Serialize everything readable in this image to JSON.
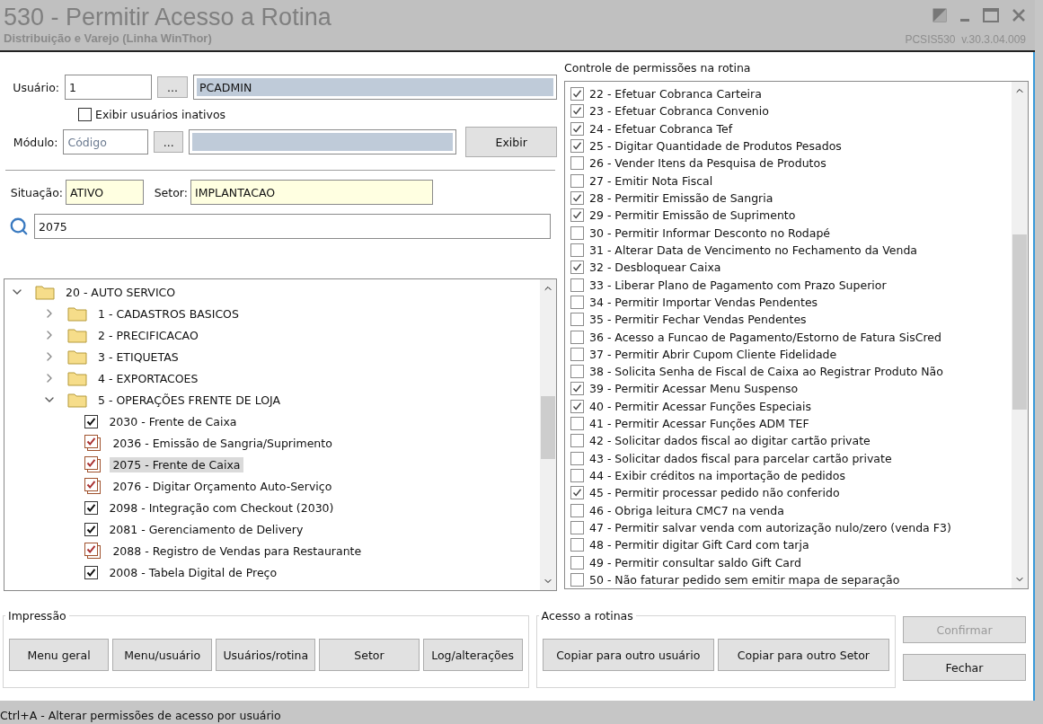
{
  "window": {
    "title": "530 - Permitir Acesso a Rotina",
    "subtitle": "Distribuição e Varejo (Linha WinThor)",
    "version": "PCSIS530  v.30.3.04.009"
  },
  "user": {
    "label": "Usuário:",
    "code": "1",
    "lookup": "...",
    "name": "PCADMIN"
  },
  "show_inactive": {
    "label": "Exibir usuários inativos",
    "checked": false
  },
  "module": {
    "label": "Módulo:",
    "placeholder": "Código",
    "lookup": "...",
    "button": "Exibir"
  },
  "situation": {
    "label": "Situação:",
    "value": "ATIVO"
  },
  "sector": {
    "label": "Setor:",
    "value": "IMPLANTACAO"
  },
  "search": {
    "value": "2075"
  },
  "tree": [
    {
      "label": "20 - AUTO SERVICO",
      "kind": "folder",
      "expanded": true,
      "children": [
        {
          "label": "1 - CADASTROS BASICOS",
          "kind": "folder",
          "expanded": false
        },
        {
          "label": "2 - PRECIFICACAO",
          "kind": "folder",
          "expanded": false
        },
        {
          "label": "3 - ETIQUETAS",
          "kind": "folder",
          "expanded": false
        },
        {
          "label": "4 - EXPORTACOES",
          "kind": "folder",
          "expanded": false
        },
        {
          "label": "5 - OPERAÇÕES FRENTE DE LOJA",
          "kind": "folder",
          "expanded": true,
          "children": [
            {
              "label": "2030 - Frente de Caixa",
              "kind": "routine",
              "checked": true,
              "multiple": false,
              "selected": false
            },
            {
              "label": "2036 - Emissão de Sangria/Suprimento",
              "kind": "routine",
              "checked": true,
              "multiple": true,
              "selected": false
            },
            {
              "label": "2075 - Frente de Caixa",
              "kind": "routine",
              "checked": true,
              "multiple": true,
              "selected": true
            },
            {
              "label": "2076 - Digitar Orçamento Auto-Serviço",
              "kind": "routine",
              "checked": true,
              "multiple": true,
              "selected": false
            },
            {
              "label": "2098 - Integração com Checkout (2030)",
              "kind": "routine",
              "checked": true,
              "multiple": false,
              "selected": false
            },
            {
              "label": "2081 - Gerenciamento de Delivery",
              "kind": "routine",
              "checked": true,
              "multiple": false,
              "selected": false
            },
            {
              "label": "2088 - Registro de Vendas para Restaurante",
              "kind": "routine",
              "checked": true,
              "multiple": true,
              "selected": false
            },
            {
              "label": "2008 - Tabela Digital de Preço",
              "kind": "routine",
              "checked": true,
              "multiple": false,
              "selected": false
            }
          ]
        }
      ]
    }
  ],
  "permissions": {
    "title": "Controle de permissões na rotina",
    "items": [
      {
        "label": "22 - Efetuar Cobranca Carteira",
        "checked": true
      },
      {
        "label": "23 - Efetuar Cobranca Convenio",
        "checked": true
      },
      {
        "label": "24 - Efetuar Cobranca Tef",
        "checked": true
      },
      {
        "label": "25 - Digitar Quantidade de Produtos Pesados",
        "checked": true
      },
      {
        "label": "26 - Vender Itens da Pesquisa de Produtos",
        "checked": false
      },
      {
        "label": "27 - Emitir Nota Fiscal",
        "checked": false
      },
      {
        "label": "28 - Permitir Emissão de Sangria",
        "checked": true
      },
      {
        "label": "29 - Permitir Emissão de Suprimento",
        "checked": true
      },
      {
        "label": "30 - Permitir Informar Desconto no Rodapé",
        "checked": false
      },
      {
        "label": "31 - Alterar Data de Vencimento no Fechamento da Venda",
        "checked": false
      },
      {
        "label": "32 - Desbloquear Caixa",
        "checked": true
      },
      {
        "label": "33 - Liberar Plano de Pagamento com Prazo Superior",
        "checked": false
      },
      {
        "label": "34 - Permitir Importar Vendas Pendentes",
        "checked": false
      },
      {
        "label": "35 - Permitir Fechar Vendas Pendentes",
        "checked": false
      },
      {
        "label": "36 - Acesso a Funcao de Pagamento/Estorno de Fatura SisCred",
        "checked": false
      },
      {
        "label": "37 - Permitir Abrir Cupom Cliente Fidelidade",
        "checked": false
      },
      {
        "label": "38 - Solicita Senha de Fiscal de Caixa ao Registrar Produto Não",
        "checked": false
      },
      {
        "label": "39 - Permitir Acessar Menu Suspenso",
        "checked": true
      },
      {
        "label": "40 - Permitir Acessar Funções Especiais",
        "checked": true
      },
      {
        "label": "41 - Permitir Acessar Funções ADM TEF",
        "checked": false
      },
      {
        "label": "42 - Solicitar dados fiscal ao digitar cartão private",
        "checked": false
      },
      {
        "label": "43 - Solicitar dados fiscal para parcelar cartão private",
        "checked": false
      },
      {
        "label": "44 - Exibir créditos na importação de pedidos",
        "checked": false
      },
      {
        "label": "45 - Permitir processar pedido não conferido",
        "checked": true
      },
      {
        "label": "46 - Obriga leitura CMC7 na venda",
        "checked": false
      },
      {
        "label": "47 - Permitir salvar venda com autorização nulo/zero (venda F3)",
        "checked": false
      },
      {
        "label": "48 - Permitir digitar Gift Card com tarja",
        "checked": false
      },
      {
        "label": "49 - Permitir consultar saldo Gift Card",
        "checked": false
      },
      {
        "label": "50 - Não faturar pedido sem emitir mapa de separação",
        "checked": false
      }
    ]
  },
  "printing": {
    "title": "Impressão",
    "buttons": [
      "Menu geral",
      "Menu/usuário",
      "Usuários/rotina",
      "Setor",
      "Log/alterações"
    ]
  },
  "access": {
    "title": "Acesso a rotinas",
    "buttons": [
      "Copiar para outro usuário",
      "Copiar para outro Setor"
    ]
  },
  "actions": [
    {
      "label": "Confirmar",
      "disabled": true
    },
    {
      "label": "Fechar",
      "disabled": false
    }
  ],
  "status_bar": "Ctrl+A - Alterar permissões de acesso por usuário"
}
